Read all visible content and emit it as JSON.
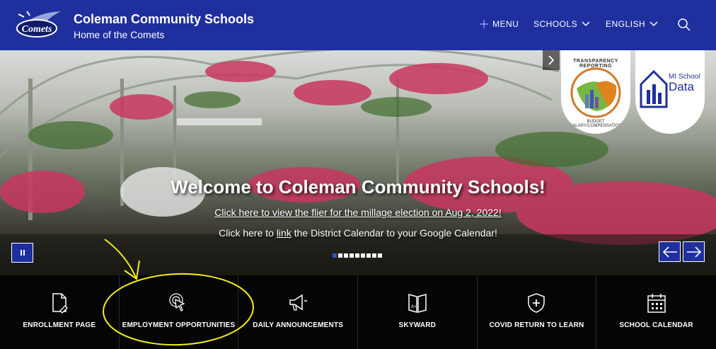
{
  "header": {
    "school_name": "Coleman Community Schools",
    "tagline": "Home of the Comets",
    "nav": {
      "menu": "MENU",
      "schools": "SCHOOLS",
      "english": "ENGLISH"
    },
    "logo_text": "Comets",
    "colors": {
      "brand": "#1f2f9e",
      "accent": "#2f52c9"
    }
  },
  "hero": {
    "welcome": "Welcome to Coleman Community Schools!",
    "flier_link": "Click here to view the flier for the millage election on Aug 2, 2022!",
    "calendar_text_pre": "Click here to ",
    "calendar_link": "link",
    "calendar_text_post": " the District Calendar to your Google Calendar!",
    "slide_count": 9,
    "active_slide": 1
  },
  "badges": {
    "transparency_top": "TRANSPARENCY REPORTING",
    "transparency_bottom": "BUDGET SALARY/COMPENSATION",
    "mi_school": "MI School",
    "data": "Data"
  },
  "quick_links": [
    {
      "label": "ENROLLMENT PAGE",
      "icon": "document-edit-icon"
    },
    {
      "label": "EMPLOYMENT OPPORTUNITIES",
      "icon": "pointer-click-icon"
    },
    {
      "label": "DAILY ANNOUNCEMENTS",
      "icon": "megaphone-icon"
    },
    {
      "label": "SKYWARD",
      "icon": "book-grade-icon"
    },
    {
      "label": "COVID RETURN TO LEARN",
      "icon": "shield-plus-icon"
    },
    {
      "label": "SCHOOL CALENDAR",
      "icon": "calendar-icon"
    }
  ]
}
